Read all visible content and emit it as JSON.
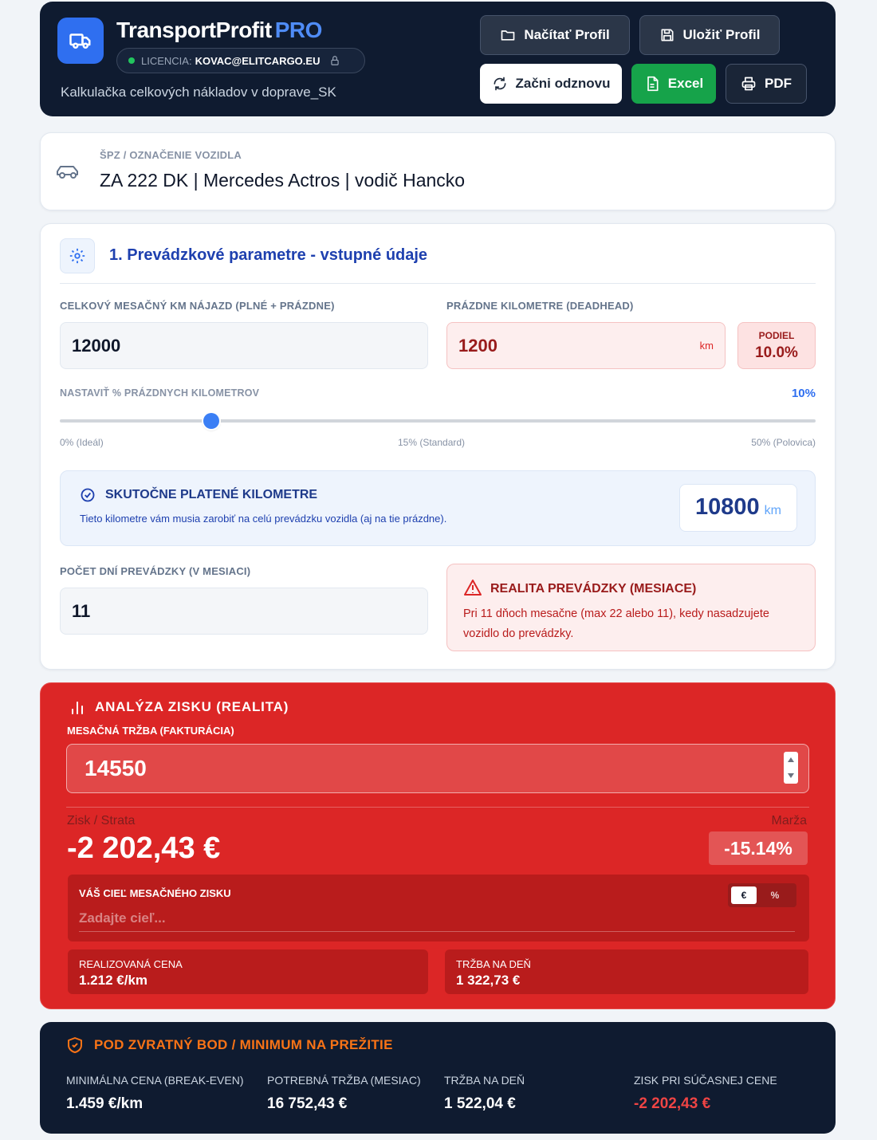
{
  "header": {
    "app_name": "TransportProfit",
    "app_badge": "PRO",
    "license_label": "LICENCIA:",
    "license_email": "KOVAC@ELITCARGO.EU",
    "subtitle": "Kalkulačka celkových nákladov v doprave_SK",
    "buttons": {
      "load_profile": "Načítať Profil",
      "save_profile": "Uložiť Profil",
      "restart": "Začni odznovu",
      "excel": "Excel",
      "pdf": "PDF"
    }
  },
  "vehicle": {
    "label": "ŠPZ / OZNAČENIE VOZIDLA",
    "value": "ZA 222 DK | Mercedes Actros | vodič Hancko"
  },
  "operational": {
    "section_title": "1. Prevádzkové parametre - vstupné údaje",
    "total_km_label": "CELKOVÝ MESAČNÝ KM NÁJAZD (PLNÉ + PRÁZDNE)",
    "total_km_value": "12000",
    "empty_km_label": "PRÁZDNE KILOMETRE (DEADHEAD)",
    "empty_km_value": "1200",
    "empty_km_unit": "km",
    "share_label": "PODIEL",
    "share_value": "10.0%",
    "slider_label": "NASTAVIŤ % PRÁZDNYCH KILOMETROV",
    "slider_value_text": "10%",
    "slider_fraction": 0.2,
    "slider_min_label": "0% (Ideál)",
    "slider_mid_label": "15% (Standard)",
    "slider_max_label": "50% (Polovica)",
    "paid_km_title": "SKUTOČNE PLATENÉ KILOMETRE",
    "paid_km_desc": "Tieto kilometre vám musia zarobiť na celú prevádzku vozidla (aj na tie prázdne).",
    "paid_km_value": "10800",
    "paid_km_unit": "km",
    "days_label": "POČET DNÍ PREVÁDZKY (V MESIACI)",
    "days_value": "11",
    "reality_title": "REALITA PREVÁDZKY (MESIACE)",
    "reality_desc": "Pri 11 dňoch mesačne (max 22 alebo 11), kedy nasadzujete vozidlo do prevádzky."
  },
  "analysis": {
    "title": "ANALÝZA ZISKU (REALITA)",
    "revenue_label": "MESAČNÁ TRŽBA (FAKTURÁCIA)",
    "revenue_value": "14550",
    "profit_label": "Zisk / Strata",
    "profit_value": "-2 202,43 €",
    "margin_label": "Marža",
    "margin_value": "-15.14%",
    "goal_label": "VÁŠ CIEĽ MESAČNÉHO ZISKU",
    "goal_placeholder": "Zadajte cieľ...",
    "toggle_eur": "€",
    "toggle_pct": "%",
    "realized_price_label": "REALIZOVANÁ CENA",
    "realized_price_value": "1.212 €/km",
    "revenue_per_day_label": "TRŽBA NA DEŇ",
    "revenue_per_day_value": "1 322,73 €"
  },
  "breakeven": {
    "title": "POD ZVRATNÝ BOD / MINIMUM NA PREŽITIE",
    "min_price_label": "MINIMÁLNA CENA (BREAK-EVEN)",
    "min_price_value": "1.459 €/km",
    "needed_revenue_label": "POTREBNÁ TRŽBA (MESIAC)",
    "needed_revenue_value": "16 752,43 €",
    "revenue_day_label": "TRŽBA NA DEŇ",
    "revenue_day_value": "1 522,04 €",
    "profit_current_label": "ZISK PRI SÚČASNEJ CENE",
    "profit_current_value": "-2 202,43 €"
  },
  "colors": {
    "accent": "#2f6ff0",
    "danger": "#dc2626",
    "success": "#16a34a",
    "warning": "#f97316",
    "navy": "#0f1b30"
  }
}
